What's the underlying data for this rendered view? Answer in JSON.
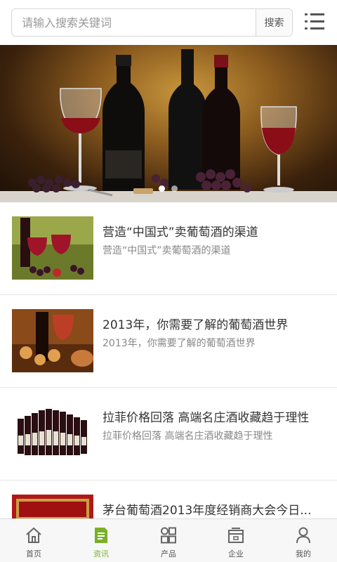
{
  "search": {
    "placeholder": "请输入搜索关键词",
    "button_label": "搜索"
  },
  "banner": {
    "slide_count": 2,
    "active_slide": 1
  },
  "news": [
    {
      "title": "营造“中国式”卖葡萄酒的渠道",
      "summary": "营造“中国式”卖葡萄酒的渠道"
    },
    {
      "title": "2013年，你需要了解的葡萄酒世界",
      "summary": "2013年，你需要了解的葡萄酒世界"
    },
    {
      "title": "拉菲价格回落 高端名庄酒收藏趋于理性",
      "summary": "拉菲价格回落 高端名庄酒收藏趋于理性"
    },
    {
      "title": "茅台葡萄酒2013年度经销商大会今日...",
      "summary": ""
    }
  ],
  "tabbar": {
    "active_color": "#7ab02a",
    "items": [
      {
        "label": "首页",
        "icon": "home-icon"
      },
      {
        "label": "资讯",
        "icon": "news-icon"
      },
      {
        "label": "产品",
        "icon": "grid-icon"
      },
      {
        "label": "企业",
        "icon": "building-icon"
      },
      {
        "label": "我的",
        "icon": "user-icon"
      }
    ]
  }
}
